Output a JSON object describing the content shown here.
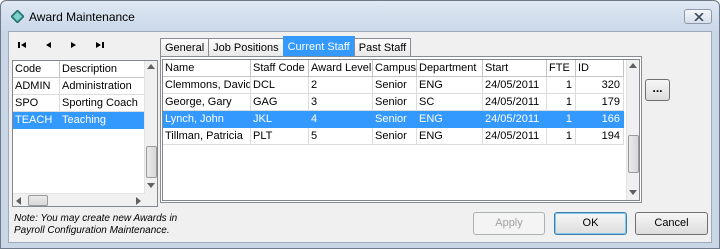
{
  "window": {
    "title": "Award Maintenance"
  },
  "navigator": {
    "first_icon": "skip-to-first-icon",
    "prev_icon": "previous-icon",
    "next_icon": "next-icon",
    "last_icon": "skip-to-last-icon"
  },
  "awards": {
    "columns": [
      "Code",
      "Description"
    ],
    "rows": [
      {
        "code": "ADMIN",
        "description": "Administration"
      },
      {
        "code": "SPO",
        "description": "Sporting Coach"
      },
      {
        "code": "TEACH",
        "description": "Teaching",
        "selected": true
      }
    ]
  },
  "tabs": [
    {
      "label": "General"
    },
    {
      "label": "Job Positions"
    },
    {
      "label": "Current Staff",
      "active": true
    },
    {
      "label": "Past Staff"
    }
  ],
  "staff": {
    "columns": [
      "Name",
      "Staff Code",
      "Award Level",
      "Campus",
      "Department",
      "Start",
      "FTE",
      "ID"
    ],
    "rows": [
      {
        "name": "Clemmons, David",
        "code": "DCL",
        "level": "2",
        "campus": "Senior",
        "dept": "ENG",
        "start": "24/05/2011",
        "fte": "1",
        "id": "320"
      },
      {
        "name": "George, Gary",
        "code": "GAG",
        "level": "3",
        "campus": "Senior",
        "dept": "SC",
        "start": "24/05/2011",
        "fte": "1",
        "id": "179"
      },
      {
        "name": "Lynch, John",
        "code": "JKL",
        "level": "4",
        "campus": "Senior",
        "dept": "ENG",
        "start": "24/05/2011",
        "fte": "1",
        "id": "166",
        "selected": true
      },
      {
        "name": "Tillman, Patricia",
        "code": "PLT",
        "level": "5",
        "campus": "Senior",
        "dept": "ENG",
        "start": "24/05/2011",
        "fte": "1",
        "id": "194"
      }
    ]
  },
  "ellipsis_label": "...",
  "note": {
    "line1": "Note: You may create new Awards in",
    "line2": "Payroll Configuration Maintenance."
  },
  "buttons": {
    "apply": "Apply",
    "ok": "OK",
    "cancel": "Cancel"
  },
  "colors": {
    "selection": "#3399ff",
    "titlebar": "#cad8ea"
  }
}
